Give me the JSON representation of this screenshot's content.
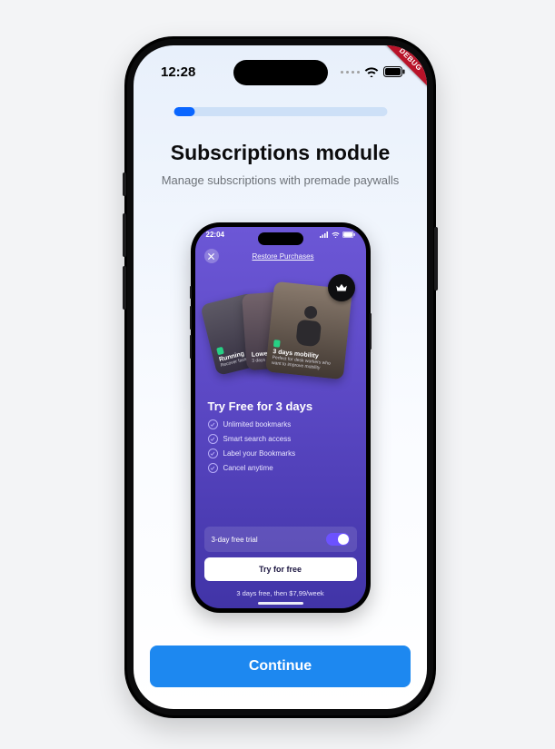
{
  "progress_percent": 10,
  "status_outer": {
    "time": "12:28"
  },
  "debug_label": "DEBUG",
  "headline": "Subscriptions module",
  "subhead": "Manage subscriptions with premade paywalls",
  "continue_label": "Continue",
  "inner": {
    "status_time": "22:04",
    "restore_label": "Restore Purchases",
    "hero_cards": {
      "left": {
        "tag": "",
        "title": "Running re",
        "desc": "Recover faster a"
      },
      "mid": {
        "tag": "",
        "title": "Lower",
        "desc": "3 days mob"
      },
      "front": {
        "tag": "",
        "title": "3 days mobility",
        "desc": "Perfect for desk workers who want to improve mobility"
      }
    },
    "try_title": "Try Free for 3 days",
    "features": [
      "Unlimited bookmarks",
      "Smart search access",
      "Label your Bookmarks",
      "Cancel anytime"
    ],
    "trial_label": "3-day free trial",
    "try_button": "Try for free",
    "price_line": "3 days free, then $7,99/week"
  },
  "colors": {
    "accent_blue": "#1d88f0",
    "progress_track": "#cde0f7",
    "paywall_top": "#6c57d6",
    "paywall_bottom": "#4134a7",
    "toggle": "#6c52ff"
  }
}
